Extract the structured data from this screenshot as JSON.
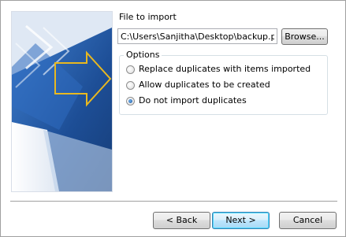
{
  "file": {
    "label": "File to import",
    "path": "C:\\Users\\Sanjitha\\Desktop\\backup.pst",
    "browse_label": "Browse..."
  },
  "options": {
    "legend": "Options",
    "items": [
      {
        "label": "Replace duplicates with items imported",
        "selected": false
      },
      {
        "label": "Allow duplicates to be created",
        "selected": false
      },
      {
        "label": "Do not import duplicates",
        "selected": true
      }
    ]
  },
  "footer": {
    "back_label": "< Back",
    "next_label": "Next >",
    "cancel_label": "Cancel"
  },
  "colors": {
    "art_dark": "#1d4e96",
    "art_light": "#d9e4f2",
    "art_arrow": "#e8b820"
  }
}
